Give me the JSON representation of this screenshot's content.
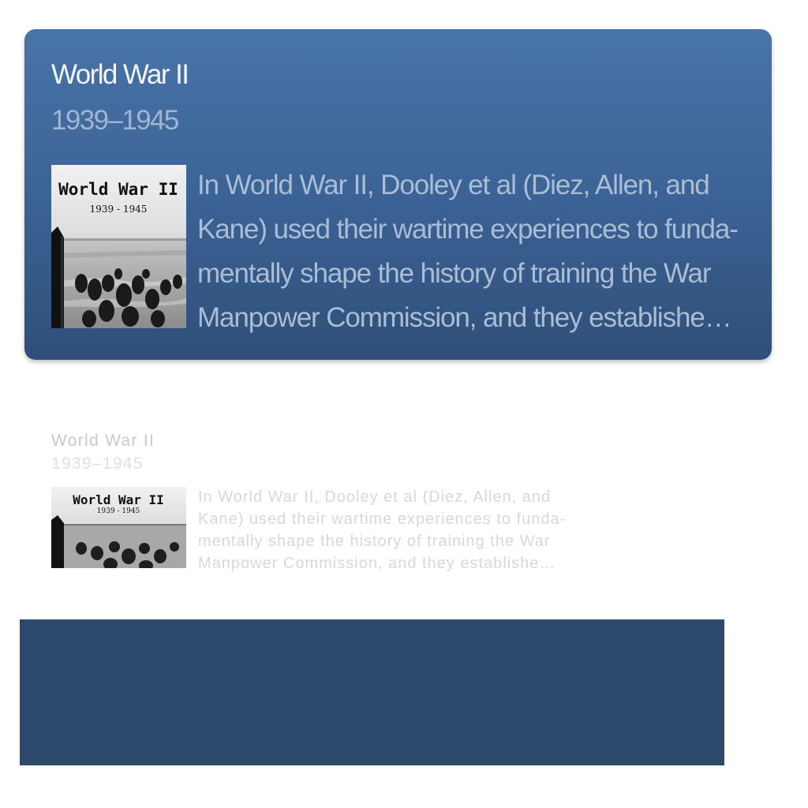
{
  "featured_card": {
    "title": "World War II",
    "date": "1939–1945",
    "description_lines": [
      "In World War II, Dooley et al (Diez, Allen, and",
      "Kane) used their wartime experiences to funda-",
      "mentally shape the history of training the War",
      "Manpower Commission, and they establishe…"
    ],
    "thumbnail": {
      "title": "World War II",
      "subtitle": "1939 - 1945"
    }
  },
  "faded_card": {
    "title": "World War II",
    "date": "1939–1945",
    "description_lines": [
      "In World War II, Dooley et al (Diez, Allen, and",
      "Kane) used their wartime experiences to funda-",
      "mentally shape the history of training the War",
      "Manpower Commission, and they establishe…"
    ],
    "thumbnail": {
      "title": "World War II",
      "subtitle": "1939 - 1945"
    }
  },
  "colors": {
    "card_gradient_top": "#4874a8",
    "card_gradient_bottom": "#2f4f78",
    "bottom_panel": "#2d4a6d"
  }
}
